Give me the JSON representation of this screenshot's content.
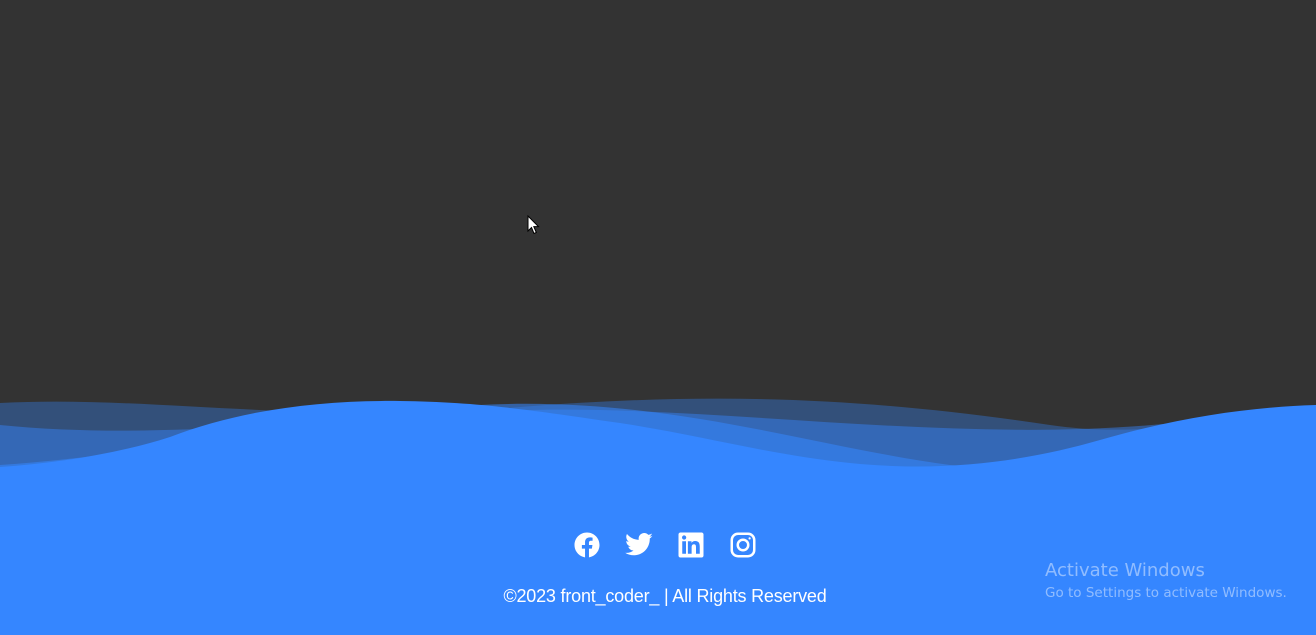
{
  "footer": {
    "copyright": "©2023 front_coder_ | All Rights Reserved",
    "social": [
      {
        "name": "facebook",
        "icon": "facebook-icon"
      },
      {
        "name": "twitter",
        "icon": "twitter-icon"
      },
      {
        "name": "linkedin",
        "icon": "linkedin-icon"
      },
      {
        "name": "instagram",
        "icon": "instagram-icon"
      }
    ]
  },
  "watermark": {
    "title": "Activate Windows",
    "subtitle": "Go to Settings to activate Windows."
  },
  "colors": {
    "background": "#333333",
    "footer_blue": "#3586ff",
    "icon_white": "#ffffff"
  }
}
